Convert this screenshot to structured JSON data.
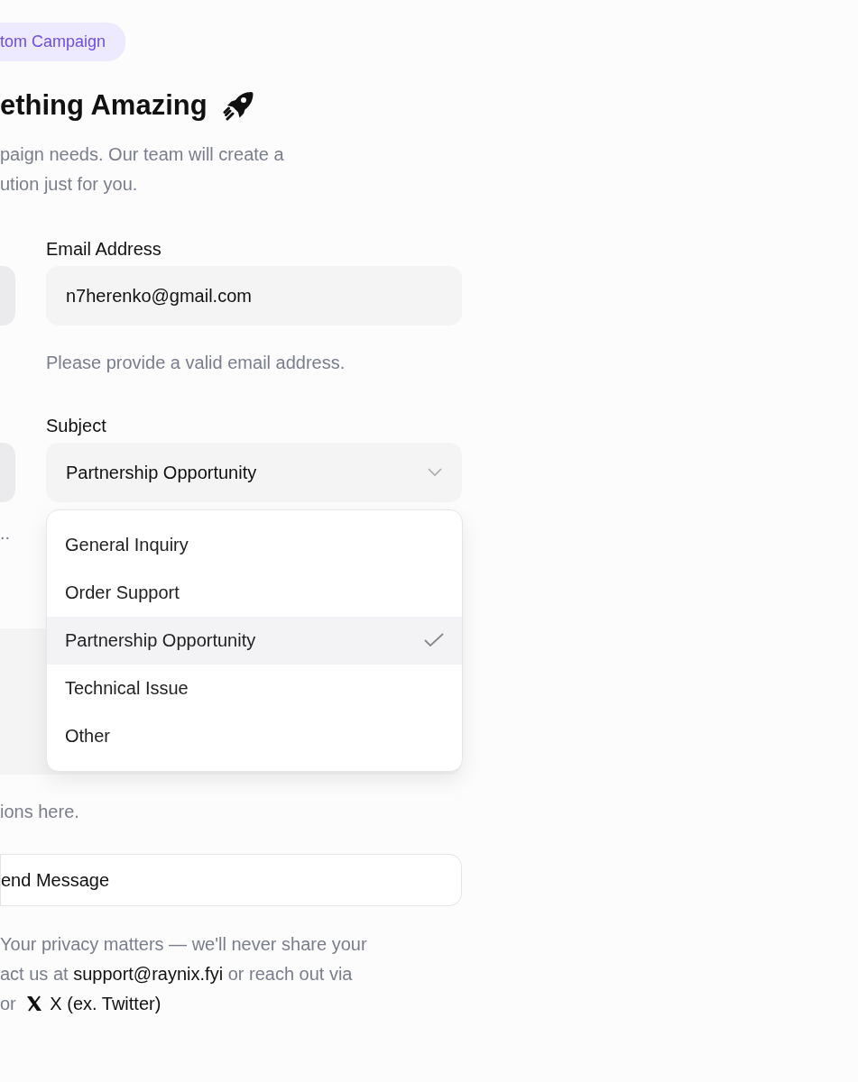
{
  "badge": "tom Campaign",
  "title": "ething Amazing",
  "subtitle": [
    "paign needs. Our team will create a",
    "ution just for you."
  ],
  "left_hint": "..",
  "email": {
    "label": "Email Address",
    "value": "n7herenko@gmail.com",
    "hint": "Please provide a valid email address."
  },
  "subject": {
    "label": "Subject",
    "value": "Partnership Opportunity",
    "expanded": true,
    "options": [
      {
        "label": "General Inquiry",
        "selected": false
      },
      {
        "label": "Order Support",
        "selected": false
      },
      {
        "label": "Partnership Opportunity",
        "selected": true
      },
      {
        "label": "Technical Issue",
        "selected": false
      },
      {
        "label": "Other",
        "selected": false
      }
    ]
  },
  "message_hint": "ions here.",
  "send_button": "end Message",
  "footer": {
    "before": "Your privacy matters — we'll never share your\nact us at ",
    "email": "support@raynix.fyi",
    "middle": " or reach out via\nor ",
    "x_link": "X (ex. Twitter)"
  }
}
